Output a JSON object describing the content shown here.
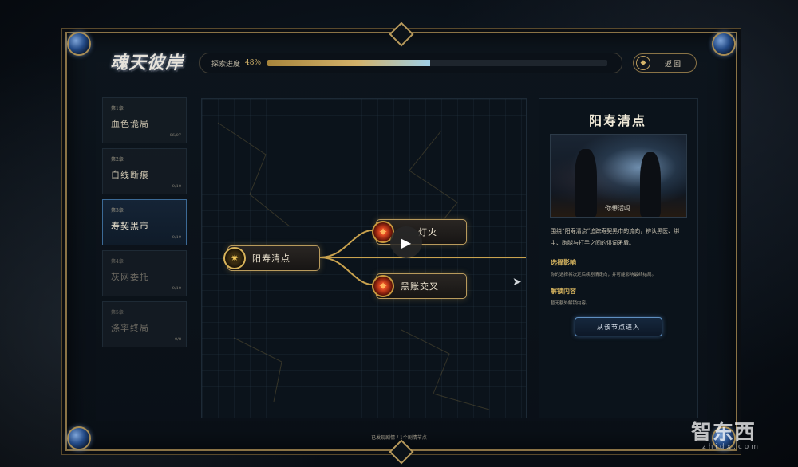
{
  "header": {
    "logo_text": "魂天彼岸",
    "progress_label": "探索进度",
    "progress_pct_text": "48%",
    "progress_value": 0.48,
    "back_label": "返回"
  },
  "chapters": [
    {
      "num": "第1章",
      "name": "血色诡局",
      "count": "06/07",
      "state": "done"
    },
    {
      "num": "第2章",
      "name": "白线断痕",
      "count": "0/10",
      "state": "done"
    },
    {
      "num": "第3章",
      "name": "寿契黑市",
      "count": "0/19",
      "state": "active"
    },
    {
      "num": "第4章",
      "name": "灰网委托",
      "count": "0/10",
      "state": "locked"
    },
    {
      "num": "第5章",
      "name": "涤率终局",
      "count": "0/8",
      "state": "locked"
    }
  ],
  "graph": {
    "nodes": [
      {
        "label": "阳寿清点",
        "gem": "gold"
      },
      {
        "label": "灯火",
        "gem": "red"
      },
      {
        "label": "黑账交叉",
        "gem": "red"
      }
    ]
  },
  "detail": {
    "title": "阳寿清点",
    "image_caption": "你想活吗",
    "description": "围绕“阳寿清点”追踪寿契黑市的流向，辨认黑医、绑主、跑腿与打手之间的供词矛盾。",
    "choice_heading": "选择影响",
    "choice_body": "你的选择将决定后续剧情走向，并可能影响最终结局。",
    "unlock_heading": "解锁内容",
    "unlock_body": "暂无额外解锁内容。",
    "enter_button": "从该节点进入"
  },
  "footer": {
    "text": "已发现剧情 / 1个剧情节点"
  },
  "watermark": {
    "main": "智东西",
    "sub": "zhidx.com"
  },
  "colors": {
    "gold": "#b89a5c",
    "accent_blue": "#5f8fc0",
    "progress_gold": "#d2b16a"
  }
}
